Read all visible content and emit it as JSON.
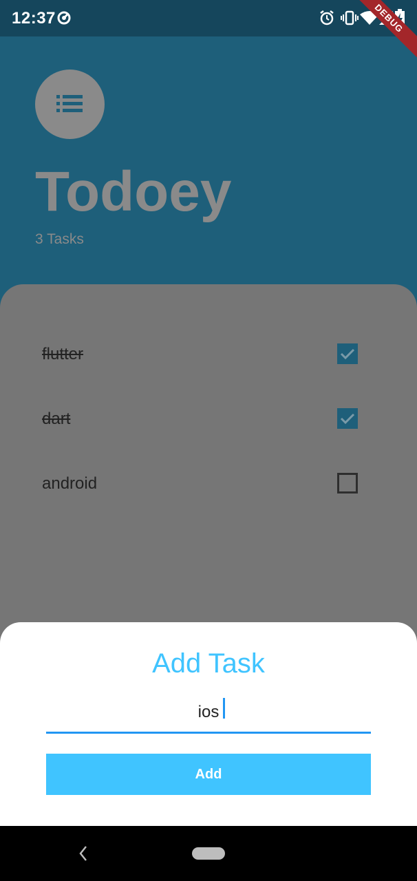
{
  "status_bar": {
    "time": "12:37",
    "icons": [
      "at-sign-icon",
      "alarm-icon",
      "vibrate-icon",
      "wifi-icon",
      "signal-icon",
      "battery-charging-icon"
    ]
  },
  "debug_banner": "DEBUG",
  "header": {
    "menu_icon": "list-icon",
    "title": "Todoey",
    "task_count": "3 Tasks"
  },
  "tasks": [
    {
      "name": "flutter",
      "done": true
    },
    {
      "name": "dart",
      "done": true
    },
    {
      "name": "android",
      "done": false
    }
  ],
  "add_sheet": {
    "title": "Add Task",
    "input_value": "ios",
    "button_label": "Add"
  },
  "nav_bar": {
    "back_icon": "chevron-left-icon",
    "home_icon": "home-pill-icon"
  },
  "colors": {
    "accent": "#40c4ff",
    "primary": "#1e5f7a",
    "underline": "#2196f3"
  }
}
